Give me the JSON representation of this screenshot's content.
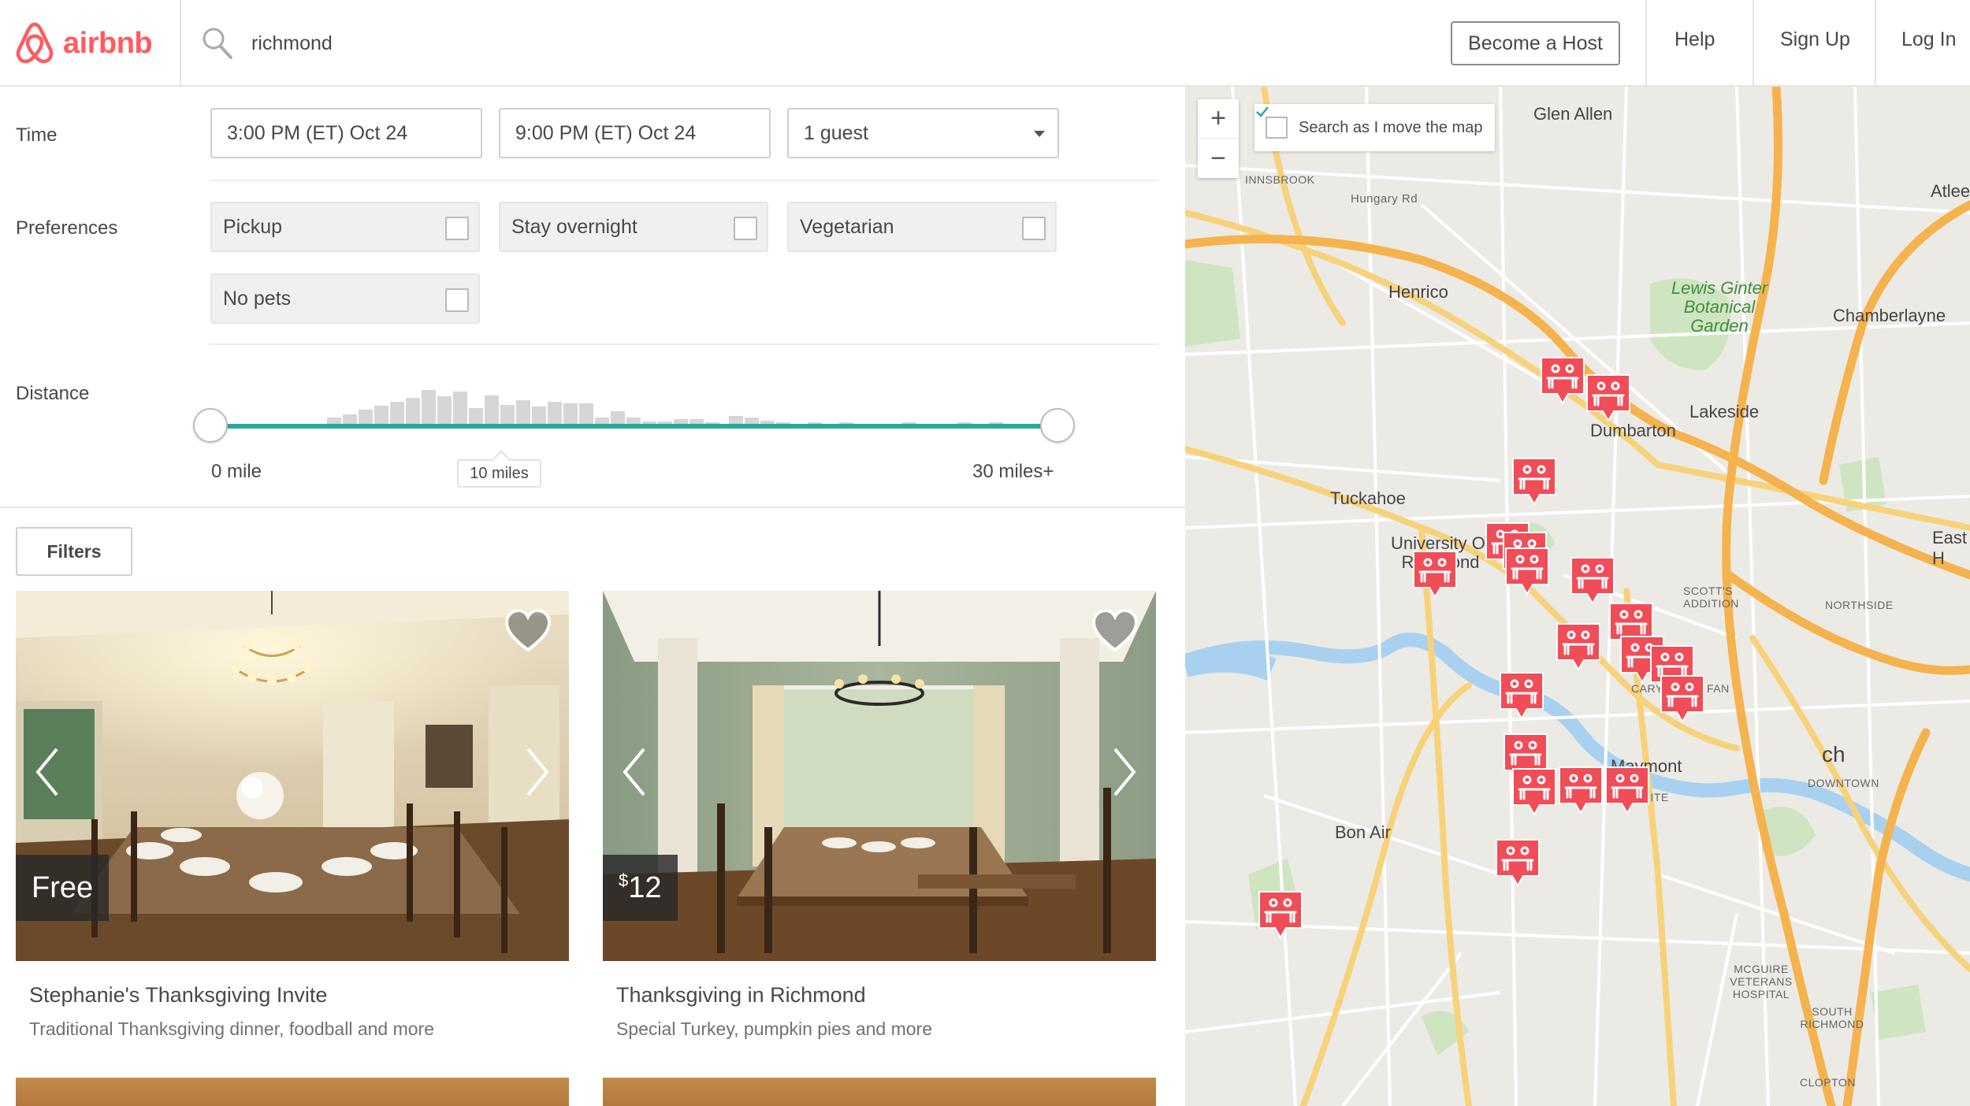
{
  "brand": {
    "name": "airbnb",
    "color": "#ff5a5f"
  },
  "header": {
    "search_value": "richmond",
    "become_host": "Become a Host",
    "help": "Help",
    "sign_up": "Sign Up",
    "log_in": "Log In"
  },
  "time": {
    "label": "Time",
    "start": "3:00 PM (ET) Oct 24",
    "end": "9:00 PM (ET) Oct 24",
    "guests": "1 guest"
  },
  "preferences": {
    "label": "Preferences",
    "items": [
      "Pickup",
      "Stay overnight",
      "Vegetarian",
      "No pets"
    ]
  },
  "distance": {
    "label": "Distance",
    "min": "0 mile",
    "tooltip": "10 miles",
    "max": "30 miles+",
    "accent": "#2aa99b"
  },
  "filters": {
    "label": "Filters"
  },
  "listings": [
    {
      "price": "Free",
      "title": "Stephanie's Thanksgiving Invite",
      "subtitle": "Traditional Thanksgiving dinner, foodball and more"
    },
    {
      "price_symbol": "$",
      "price": "12",
      "title": "Thanksgiving in Richmond",
      "subtitle": "Special Turkey, pumpkin pies and more"
    }
  ],
  "map": {
    "search_as_move": "Search as I move the map",
    "zoom_in": "+",
    "zoom_out": "−",
    "places": {
      "glen_allen": "Glen Allen",
      "innsbrook": "INNSBROOK",
      "hungary_rd": "Hungary Rd",
      "henrico": "Henrico",
      "lewis_ginter": "Lewis Ginter Botanical Garden",
      "chamberlayne": "Chamberlayne",
      "lakeside": "Lakeside",
      "dumbarton": "Dumbarton",
      "tuckahoe": "Tuckahoe",
      "university": "University Of Richmond",
      "east_h": "East H",
      "scotts": "SCOTT'S ADDITION",
      "northside": "NORTHSIDE",
      "carytown": "CARYTOWN",
      "fan": "FAN",
      "maymont": "Maymont",
      "downtown": "DOWNTOWN",
      "granite": "GRANITE",
      "bon_air": "Bon Air",
      "mcguire": "MCGUIRE VETERANS HOSPITAL",
      "south_richmond": "SOUTH RICHMOND",
      "clopton": "CLOPTON",
      "atlee": "Atlee",
      "ch": "ch"
    }
  }
}
